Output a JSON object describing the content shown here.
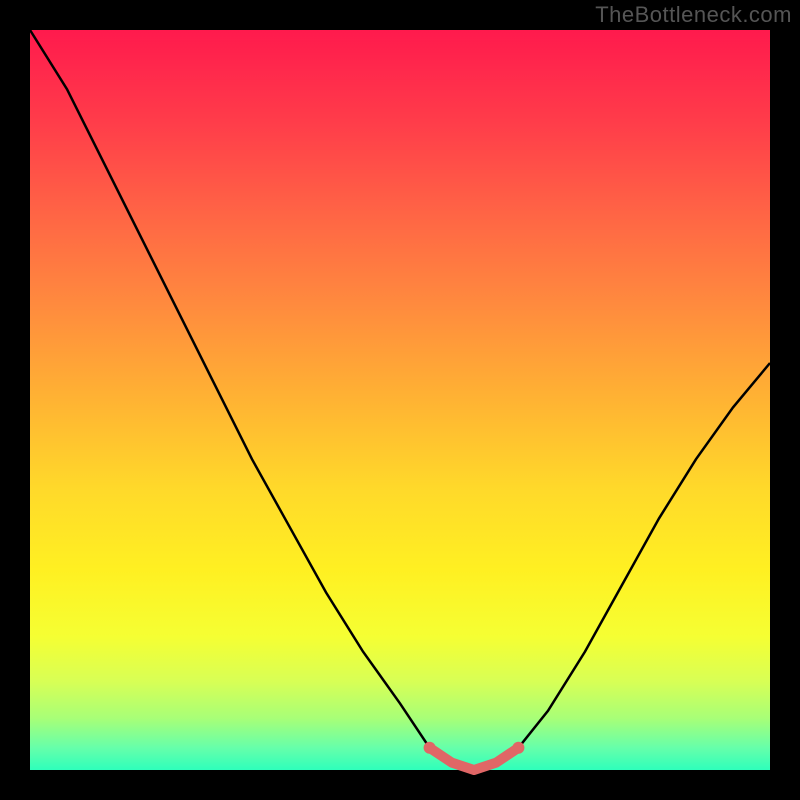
{
  "watermark": "TheBottleneck.com",
  "colors": {
    "frame": "#000000",
    "curve": "#000000",
    "valley_highlight": "#e06666"
  },
  "chart_data": {
    "type": "line",
    "title": "",
    "xlabel": "",
    "ylabel": "",
    "x": [
      0.0,
      0.05,
      0.1,
      0.15,
      0.2,
      0.25,
      0.3,
      0.35,
      0.4,
      0.45,
      0.5,
      0.54,
      0.57,
      0.6,
      0.63,
      0.66,
      0.7,
      0.75,
      0.8,
      0.85,
      0.9,
      0.95,
      1.0
    ],
    "values": [
      1.0,
      0.92,
      0.82,
      0.72,
      0.62,
      0.52,
      0.42,
      0.33,
      0.24,
      0.16,
      0.09,
      0.03,
      0.01,
      0.0,
      0.01,
      0.03,
      0.08,
      0.16,
      0.25,
      0.34,
      0.42,
      0.49,
      0.55
    ],
    "xlim": [
      0,
      1
    ],
    "ylim": [
      0,
      1
    ],
    "valley_highlight_x_range": [
      0.54,
      0.66
    ],
    "annotations": []
  }
}
